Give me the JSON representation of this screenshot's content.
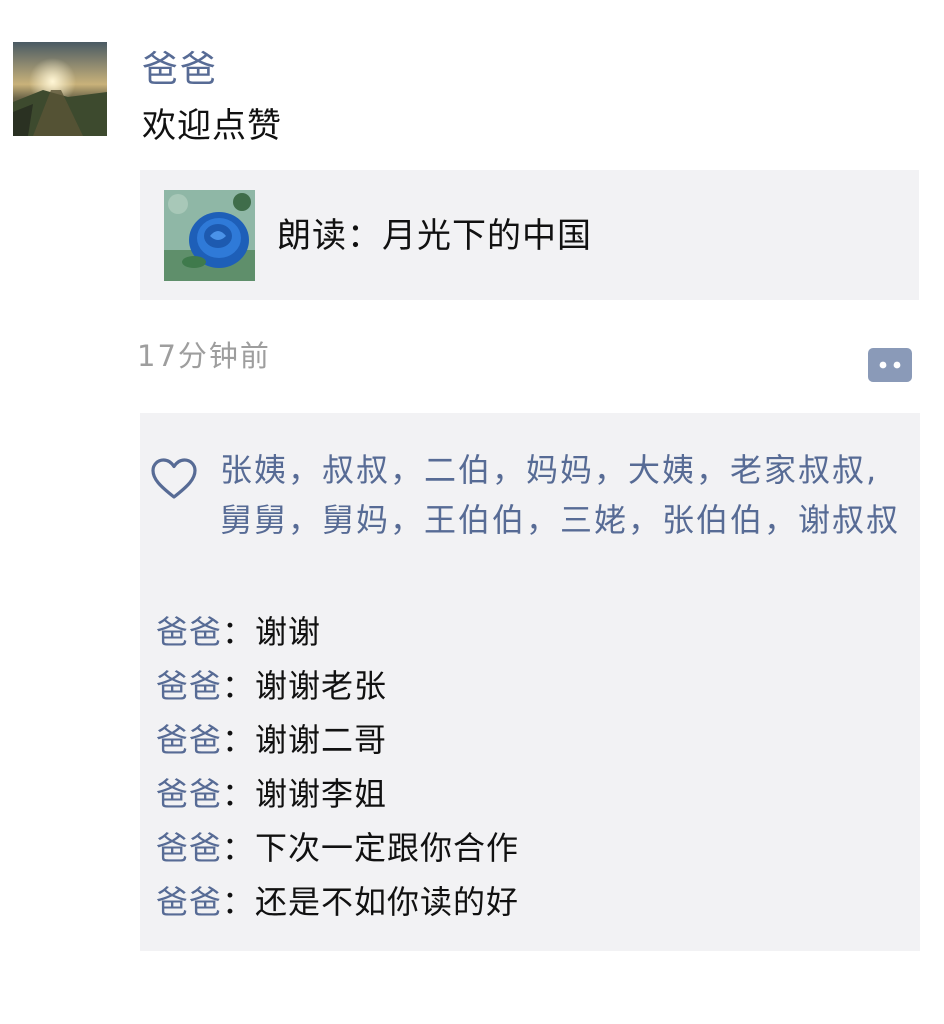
{
  "post": {
    "author": "爸爸",
    "text": "欢迎点赞",
    "share": {
      "title": "朗读：月光下的中国",
      "thumb_icon": "blue-rose-thumbnail"
    },
    "timestamp": "17分钟前",
    "comment_button_icon": "comment-dots-icon"
  },
  "likes": {
    "icon": "heart-outline-icon",
    "names": "张姨，叔叔，二伯，妈妈，大姨，老家叔叔,舅舅，舅妈，王伯伯，三姥，张伯伯，谢叔叔"
  },
  "comments": [
    {
      "author": "爸爸",
      "sep": "：",
      "text": "谢谢"
    },
    {
      "author": "爸爸",
      "sep": "：",
      "text": "谢谢老张"
    },
    {
      "author": "爸爸",
      "sep": "：",
      "text": "谢谢二哥"
    },
    {
      "author": "爸爸",
      "sep": "：",
      "text": "谢谢李姐"
    },
    {
      "author": "爸爸",
      "sep": "：",
      "text": "下次一定跟你合作"
    },
    {
      "author": "爸爸",
      "sep": "：",
      "text": "还是不如你读的好"
    }
  ],
  "colors": {
    "name_link": "#576b95",
    "card_bg": "#f2f2f4",
    "timestamp": "#9e9e9e",
    "text": "#111111"
  }
}
